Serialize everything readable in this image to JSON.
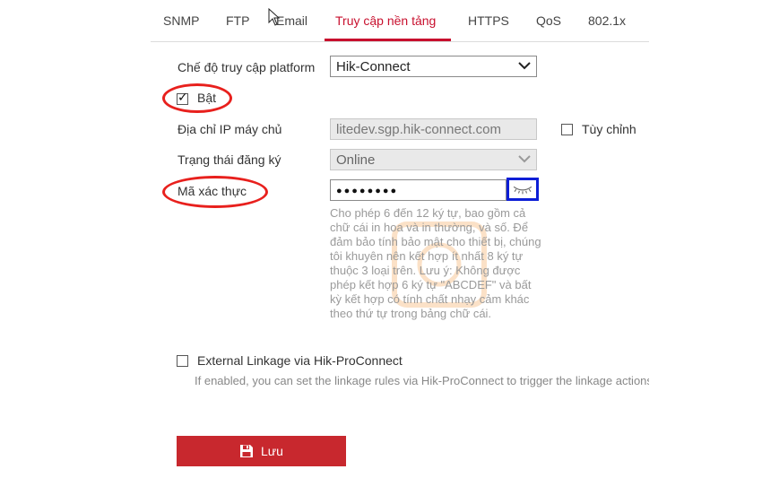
{
  "tabs": [
    {
      "label": "SNMP"
    },
    {
      "label": "FTP"
    },
    {
      "label": "Email"
    },
    {
      "label": "Truy cập nền tảng"
    },
    {
      "label": "HTTPS"
    },
    {
      "label": "QoS"
    },
    {
      "label": "802.1x"
    }
  ],
  "active_tab": "Truy cập nền tảng",
  "form": {
    "platform_mode_label": "Chế độ truy cập platform",
    "platform_mode_value": "Hik-Connect",
    "enable_label": "Bật",
    "enable_checked": true,
    "server_ip_label": "Địa chỉ IP máy chủ",
    "server_ip_value": "litedev.sgp.hik-connect.com",
    "custom_label": "Tùy chỉnh",
    "custom_checked": false,
    "reg_status_label": "Trạng thái đăng ký",
    "reg_status_value": "Online",
    "verify_code_label": "Mã xác thực",
    "verify_code_value": "●●●●●●●●",
    "hint": "Cho phép 6 đến 12 ký tự, bao gồm cả chữ cái in hoa và in thường, và số. Để đảm bảo tính bảo mật cho thiết bị, chúng tôi khuyên nên kết hợp ít nhất 8 ký tự thuộc 3 loại trên. Lưu ý: Không được phép kết hợp 6 ký tự \"ABCDEF\" và bất kỳ kết hợp có tính chất nhạy cảm khác theo thứ tự trong bảng chữ cái.",
    "ext_linkage_label": "External Linkage via Hik-ProConnect",
    "ext_linkage_checked": false,
    "ext_linkage_desc": "If enabled, you can set the linkage rules via Hik-ProConnect to trigger the linkage actions."
  },
  "save_label": "Lưu",
  "icons": {
    "eye": "eye-closed-icon",
    "save": "floppy-disk-icon",
    "chevron": "chevron-down-icon"
  },
  "colors": {
    "accent": "#c8102e",
    "save_button": "#c8282e",
    "highlight_oval": "#e8201d",
    "highlight_box": "#0d1fd6"
  }
}
